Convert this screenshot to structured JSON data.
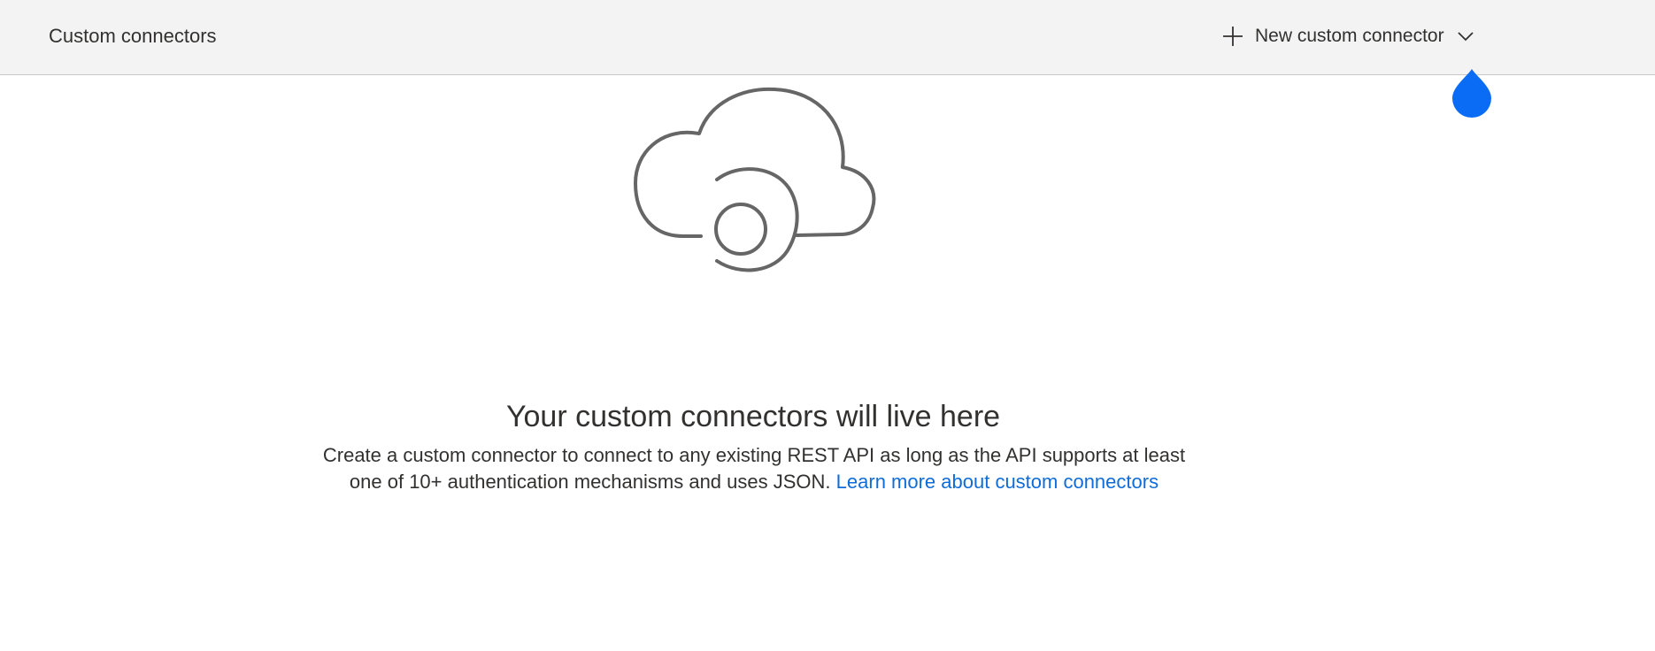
{
  "header": {
    "title": "Custom connectors",
    "new_button": {
      "label": "New custom connector",
      "icon": "plus-icon",
      "dropdown_icon": "chevron-down-icon"
    }
  },
  "empty_state": {
    "illustration": "cloud-connector-icon",
    "heading": "Your custom connectors will live here",
    "description": "Create a custom connector to connect to any existing REST API as long as the API supports at least one of 10+ authentication mechanisms and uses JSON.",
    "link_text": "Learn more about custom connectors"
  },
  "colors": {
    "link": "#0f6cd8",
    "pointer": "#0a6cf5",
    "header_bg": "#f3f3f3"
  }
}
